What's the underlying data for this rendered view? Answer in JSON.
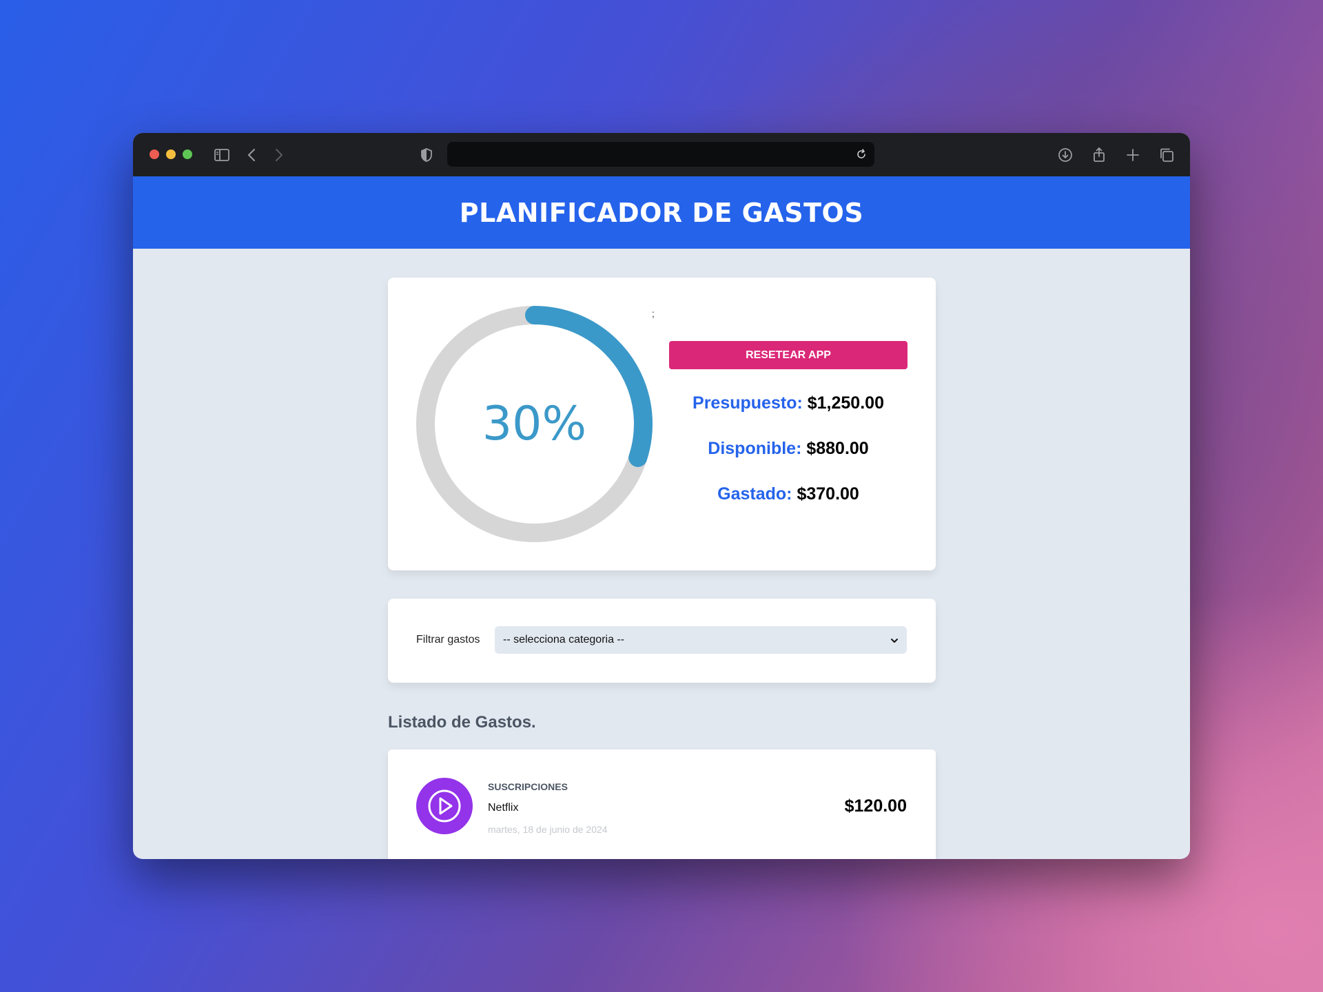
{
  "app": {
    "title": "PLANIFICADOR DE GASTOS",
    "stray_char": ";"
  },
  "budget": {
    "percent_spent": 30,
    "percent_label": "30%",
    "reset_label": "Resetear App",
    "presupuesto_label": "Presupuesto:",
    "presupuesto_value": "$1,250.00",
    "disponible_label": "Disponible:",
    "disponible_value": "$880.00",
    "gastado_label": "Gastado:",
    "gastado_value": "$370.00"
  },
  "filter": {
    "label": "Filtrar gastos",
    "selected": "-- selecciona categoria --"
  },
  "list": {
    "title": "Listado de Gastos.",
    "items": [
      {
        "category": "Suscripciones",
        "name": "Netflix",
        "date": "martes, 18 de junio de 2024",
        "amount": "$120.00",
        "icon": "play-icon"
      }
    ]
  },
  "colors": {
    "brand": "#2563eb",
    "accent": "#db2777",
    "progress": "#3b99c9",
    "track": "#d6d6d6",
    "subscription": "#9333ea"
  }
}
